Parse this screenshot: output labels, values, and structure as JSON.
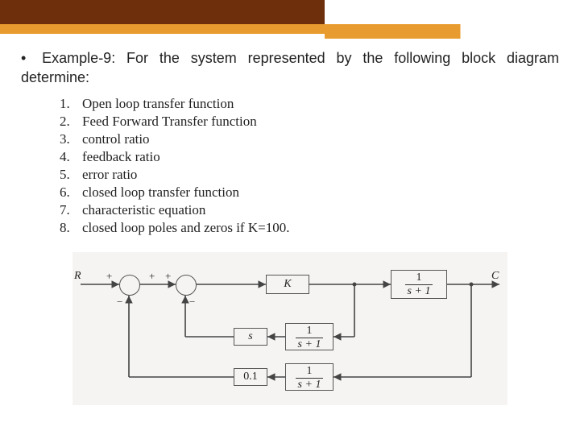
{
  "prompt": {
    "bullet": "•",
    "text": "Example-9: For the system represented by the following block diagram determine:"
  },
  "items": [
    {
      "n": "1.",
      "t": "Open loop transfer function"
    },
    {
      "n": "2.",
      "t": "Feed Forward Transfer function"
    },
    {
      "n": "3.",
      "t": "control ratio"
    },
    {
      "n": "4.",
      "t": "feedback ratio"
    },
    {
      "n": "5.",
      "t": "error ratio"
    },
    {
      "n": "6.",
      "t": "closed loop transfer function"
    },
    {
      "n": "7.",
      "t": "characteristic equation"
    },
    {
      "n": "8.",
      "t": "closed loop poles and zeros if K=100."
    }
  ],
  "diagram": {
    "input_label": "R",
    "output_label": "C",
    "sum1": {
      "plus1": "+",
      "minus": "−",
      "plus2": "+"
    },
    "sum2": {
      "plus": "+",
      "minus": "−"
    },
    "blocks": {
      "K_label": "K",
      "main_frac_num": "1",
      "main_frac_den": "s + 1",
      "fb_inner_label": "s",
      "fb_mid_num": "1",
      "fb_mid_den": "s + 1",
      "fb_outer_gain": "0.1",
      "fb_outer_num": "1",
      "fb_outer_den": "s + 1"
    }
  },
  "chart_data": {
    "type": "table",
    "title": "Block diagram topology for closed-loop control system",
    "nodes": [
      {
        "id": "R",
        "kind": "input"
      },
      {
        "id": "sum1",
        "kind": "summing_junction",
        "signs": [
          "+",
          "−"
        ]
      },
      {
        "id": "sum2",
        "kind": "summing_junction",
        "signs": [
          "+",
          "−"
        ]
      },
      {
        "id": "K",
        "kind": "gain",
        "value": "K"
      },
      {
        "id": "G",
        "kind": "transfer_function",
        "value": "1/(s+1)"
      },
      {
        "id": "C",
        "kind": "output"
      },
      {
        "id": "H_inner",
        "kind": "transfer_function",
        "value": "s"
      },
      {
        "id": "H_mid",
        "kind": "transfer_function",
        "value": "1/(s+1)"
      },
      {
        "id": "H_outer_gain",
        "kind": "gain",
        "value": "0.1"
      },
      {
        "id": "H_outer",
        "kind": "transfer_function",
        "value": "1/(s+1)"
      }
    ],
    "edges": [
      [
        "R",
        "sum1",
        "+"
      ],
      [
        "sum1",
        "sum2",
        "+"
      ],
      [
        "sum2",
        "K",
        ""
      ],
      [
        "K",
        "G",
        ""
      ],
      [
        "G",
        "C",
        ""
      ],
      [
        "G",
        "H_mid",
        "pickoff"
      ],
      [
        "H_mid",
        "H_inner",
        ""
      ],
      [
        "H_inner",
        "sum2",
        "−"
      ],
      [
        "C",
        "H_outer",
        "pickoff"
      ],
      [
        "H_outer",
        "H_outer_gain",
        ""
      ],
      [
        "H_outer_gain",
        "sum1",
        "−"
      ]
    ]
  }
}
